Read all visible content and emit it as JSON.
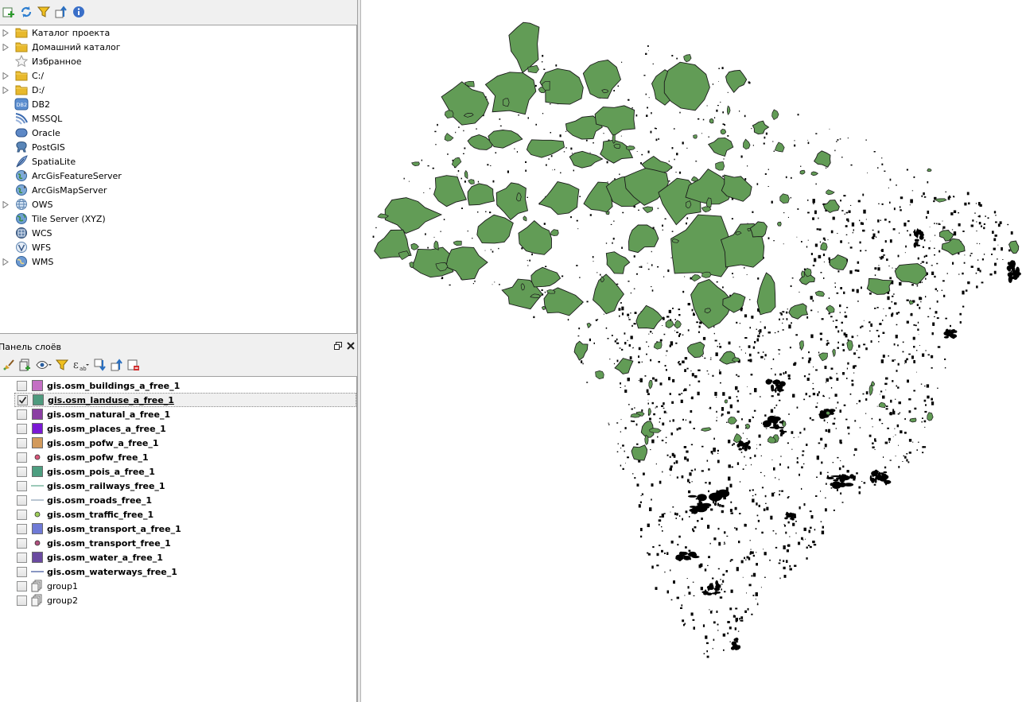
{
  "browser": {
    "toolbar": [
      {
        "icon": "add-layer-icon"
      },
      {
        "icon": "refresh-icon"
      },
      {
        "icon": "filter-icon"
      },
      {
        "icon": "collapse-all-icon"
      },
      {
        "icon": "info-icon"
      }
    ],
    "items": [
      {
        "label": "Каталог проекта",
        "icon": "folder-icon",
        "expandable": true
      },
      {
        "label": "Домашний каталог",
        "icon": "folder-icon",
        "expandable": true
      },
      {
        "label": "Избранное",
        "icon": "star-icon",
        "expandable": false
      },
      {
        "label": "C:/",
        "icon": "folder-icon",
        "expandable": true
      },
      {
        "label": "D:/",
        "icon": "folder-icon",
        "expandable": true
      },
      {
        "label": "DB2",
        "icon": "db2-icon",
        "expandable": false
      },
      {
        "label": "MSSQL",
        "icon": "mssql-icon",
        "expandable": false
      },
      {
        "label": "Oracle",
        "icon": "oracle-icon",
        "expandable": false
      },
      {
        "label": "PostGIS",
        "icon": "postgis-elephant-icon",
        "expandable": false
      },
      {
        "label": "SpatiaLite",
        "icon": "spatialite-feather-icon",
        "expandable": false
      },
      {
        "label": "ArcGisFeatureServer",
        "icon": "arcgis-globe-icon",
        "expandable": false
      },
      {
        "label": "ArcGisMapServer",
        "icon": "arcgis-globe-icon",
        "expandable": false
      },
      {
        "label": "OWS",
        "icon": "ows-globe-icon",
        "expandable": true
      },
      {
        "label": "Tile Server (XYZ)",
        "icon": "xyz-globe-icon",
        "expandable": false
      },
      {
        "label": "WCS",
        "icon": "wcs-globe-icon",
        "expandable": false
      },
      {
        "label": "WFS",
        "icon": "wfs-globe-icon",
        "expandable": false
      },
      {
        "label": "WMS",
        "icon": "wms-globe-icon",
        "expandable": true
      }
    ]
  },
  "layers_panel": {
    "title": "Панель слоёв",
    "toolbar": [
      {
        "icon": "style-brush-icon"
      },
      {
        "icon": "add-group-icon"
      },
      {
        "icon": "visibility-eye-icon"
      },
      {
        "icon": "filter-icon"
      },
      {
        "icon": "expression-filter-icon"
      },
      {
        "icon": "expand-all-icon"
      },
      {
        "icon": "collapse-all-icon"
      },
      {
        "icon": "remove-layer-icon"
      }
    ],
    "layers": [
      {
        "name": "gis.osm_buildings_a_free_1",
        "symbol": "fill",
        "color": "#c46fc4",
        "checked": false,
        "bold": true
      },
      {
        "name": "gis.osm_landuse_a_free_1",
        "symbol": "fill",
        "color": "#4e9a7e",
        "checked": true,
        "bold": true,
        "selected": true
      },
      {
        "name": "gis.osm_natural_a_free_1",
        "symbol": "fill",
        "color": "#8b3fa3",
        "checked": false,
        "bold": true
      },
      {
        "name": "gis.osm_places_a_free_1",
        "symbol": "fill",
        "color": "#7a18d4",
        "checked": false,
        "bold": true
      },
      {
        "name": "gis.osm_pofw_a_free_1",
        "symbol": "fill",
        "color": "#d29a5c",
        "checked": false,
        "bold": true
      },
      {
        "name": "gis.osm_pofw_free_1",
        "symbol": "point",
        "color": "#d9577a",
        "checked": false,
        "bold": true
      },
      {
        "name": "gis.osm_pois_a_free_1",
        "symbol": "fill",
        "color": "#4d9e80",
        "checked": false,
        "bold": true
      },
      {
        "name": "gis.osm_railways_free_1",
        "symbol": "line",
        "color": "#5aa58a",
        "checked": false,
        "bold": true
      },
      {
        "name": "gis.osm_roads_free_1",
        "symbol": "line",
        "color": "#8aa0b4",
        "checked": false,
        "bold": true
      },
      {
        "name": "gis.osm_traffic_free_1",
        "symbol": "point",
        "color": "#9fcf5a",
        "checked": false,
        "bold": true
      },
      {
        "name": "gis.osm_transport_a_free_1",
        "symbol": "fill",
        "color": "#6f7ad6",
        "checked": false,
        "bold": true
      },
      {
        "name": "gis.osm_transport_free_1",
        "symbol": "point",
        "color": "#b0507e",
        "checked": false,
        "bold": true
      },
      {
        "name": "gis.osm_water_a_free_1",
        "symbol": "fill",
        "color": "#6a4aa0",
        "checked": false,
        "bold": true
      },
      {
        "name": "gis.osm_waterways_free_1",
        "symbol": "line",
        "color": "#3a4f9a",
        "checked": false,
        "bold": true
      },
      {
        "name": "group1",
        "symbol": "group",
        "color": "#777777",
        "checked": false,
        "bold": false
      },
      {
        "name": "group2",
        "symbol": "group",
        "color": "#777777",
        "checked": false,
        "bold": false
      }
    ]
  },
  "map": {
    "polygon_fill": "#629c56",
    "polygon_stroke": "#1a1a1a",
    "feature_color": "#000000"
  }
}
